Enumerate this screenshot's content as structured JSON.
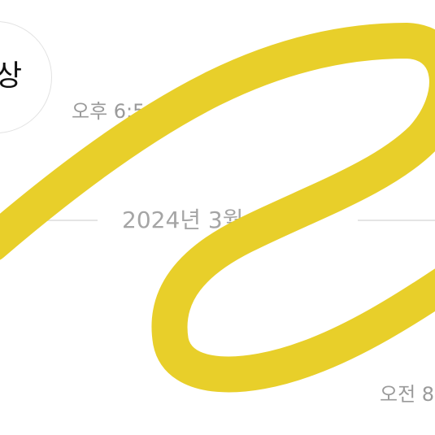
{
  "chat": {
    "bubble_text": "상",
    "timestamp_1": "오후 6:5",
    "date_divider": "2024년 3월 2",
    "timestamp_2": "오전 8"
  },
  "overlay": {
    "scribble_color": "#E8CF2A"
  }
}
